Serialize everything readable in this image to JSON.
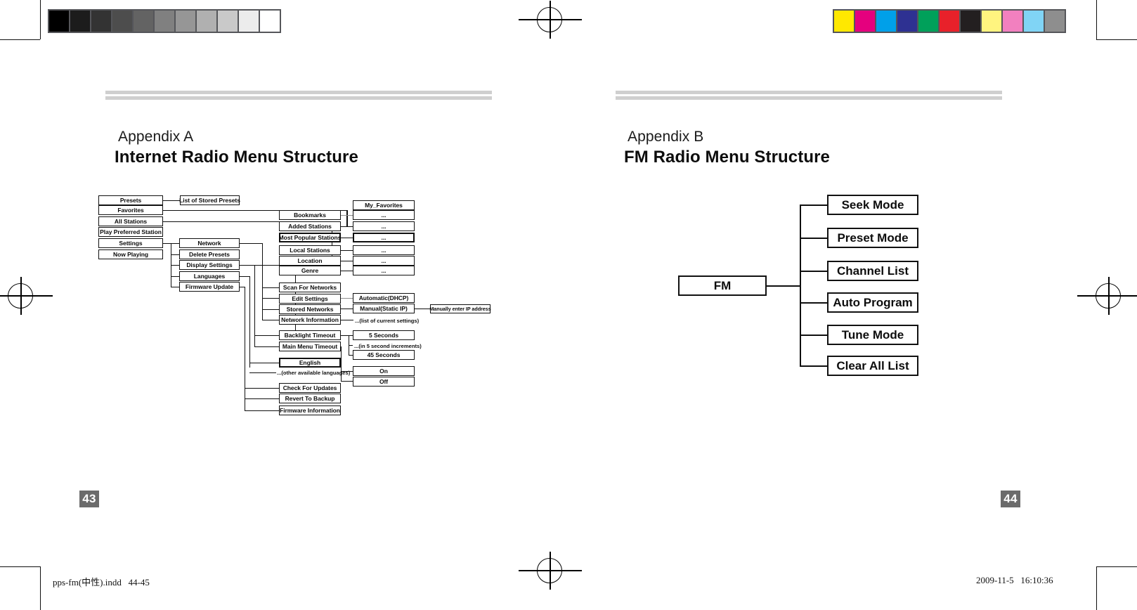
{
  "printer_marks": {
    "grayscale_swatches": [
      "#000000",
      "#1c1c1c",
      "#333333",
      "#4d4d4d",
      "#636363",
      "#808080",
      "#969696",
      "#b0b0b0",
      "#c9c9c9",
      "#ececec",
      "#ffffff"
    ],
    "color_swatches": [
      "#ffe800",
      "#e5007e",
      "#00a0e9",
      "#2e3192",
      "#00a05a",
      "#e8212a",
      "#231f20",
      "#fff47f",
      "#f280bf",
      "#80d4f5",
      "#8e8e8e"
    ]
  },
  "left_page": {
    "appendix_label": "Appendix A",
    "appendix_title": "Internet Radio Menu Structure",
    "page_number": "43",
    "footer": "pps-fm(中性).indd   44-45",
    "diagram": {
      "level1": [
        "Presets",
        "Favorites",
        "All Stations",
        "Play Preferred Station",
        "Settings",
        "Now Playing"
      ],
      "presets_child": "List of Stored Presets",
      "settings_children": [
        "Network",
        "Delete Presets",
        "Display Settings",
        "Languages",
        "Firmware Update"
      ],
      "stations_children": [
        "Bookmarks",
        "Added Stations",
        "Most Popular Stations",
        "Local Stations",
        "Location",
        "Genre"
      ],
      "stations_leaf": [
        "My_Favorites",
        "...",
        "...",
        "...",
        "...",
        "...",
        "..."
      ],
      "network_children": [
        "Scan For Networks",
        "Edit Settings",
        "Stored Networks",
        "Network Information"
      ],
      "edit_settings_children": [
        "Automatic(DHCP)",
        "Manual(Static IP)"
      ],
      "manual_leaf": "Manually enter IP address",
      "network_info_note": "...(list of current settings)",
      "display_children": [
        "Backlight Timeout",
        "Main Menu Timeout"
      ],
      "timeout_options": [
        "5 Seconds",
        "45 Seconds"
      ],
      "timeout_note": "...(in 5 second increments)",
      "language_main": "English",
      "language_note": "...(other available languages)",
      "onoff": [
        "On",
        "Off"
      ],
      "firmware_children": [
        "Check For Updates",
        "Revert To Backup",
        "Firmware Information"
      ]
    }
  },
  "right_page": {
    "appendix_label": "Appendix B",
    "appendix_title": "FM Radio Menu Structure",
    "page_number": "44",
    "footer": "2009-11-5   16:10:36",
    "diagram": {
      "root": "FM",
      "children": [
        "Seek Mode",
        "Preset Mode",
        "Channel List",
        "Auto Program",
        "Tune Mode",
        "Clear All List"
      ]
    }
  }
}
